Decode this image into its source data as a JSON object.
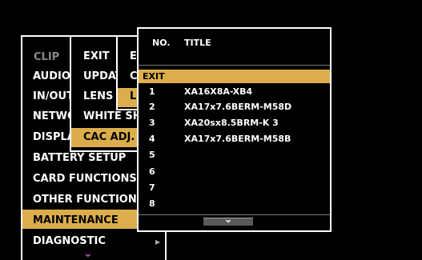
{
  "main_menu": {
    "items": [
      {
        "label": "CLIP",
        "dimmed": true
      },
      {
        "label": "AUDIO"
      },
      {
        "label": "IN/OUT"
      },
      {
        "label": "NETWORK"
      },
      {
        "label": "DISPLAY"
      },
      {
        "label": "BATTERY SETUP"
      },
      {
        "label": "CARD FUNCTIONS"
      },
      {
        "label": "OTHER FUNCTIONS"
      },
      {
        "label": "MAINTENANCE",
        "selected": true
      },
      {
        "label": "DIAGNOSTIC"
      }
    ],
    "scroll_down_glyph": "⌄"
  },
  "submenu_1": {
    "items": [
      "EXIT",
      "UPDATE",
      "LENS",
      "WHITE SHADING",
      "CAC ADJ."
    ],
    "selected_index": 4
  },
  "submenu_2": {
    "items": [
      "EXIT",
      "CAC",
      "LENS"
    ],
    "selected_index": 2
  },
  "popup": {
    "header": {
      "no": "NO.",
      "title": "TITLE"
    },
    "exit_label": "EXIT",
    "rows": [
      {
        "no": "1",
        "title": "XA16X8A-XB4"
      },
      {
        "no": "2",
        "title": "XA17x7.6BERM-M58D"
      },
      {
        "no": "3",
        "title": "XA20sx8.5BRM-K 3"
      },
      {
        "no": "4",
        "title": "XA17x7.6BERM-M58B"
      },
      {
        "no": "5",
        "title": ""
      },
      {
        "no": "6",
        "title": ""
      },
      {
        "no": "7",
        "title": ""
      },
      {
        "no": "8",
        "title": ""
      }
    ],
    "scroll_glyph": "⌄"
  },
  "colors": {
    "highlight": "#dcae4b",
    "dimmed_text": "#8a8a8a",
    "background": "#000000",
    "frame": "#ffffff"
  }
}
